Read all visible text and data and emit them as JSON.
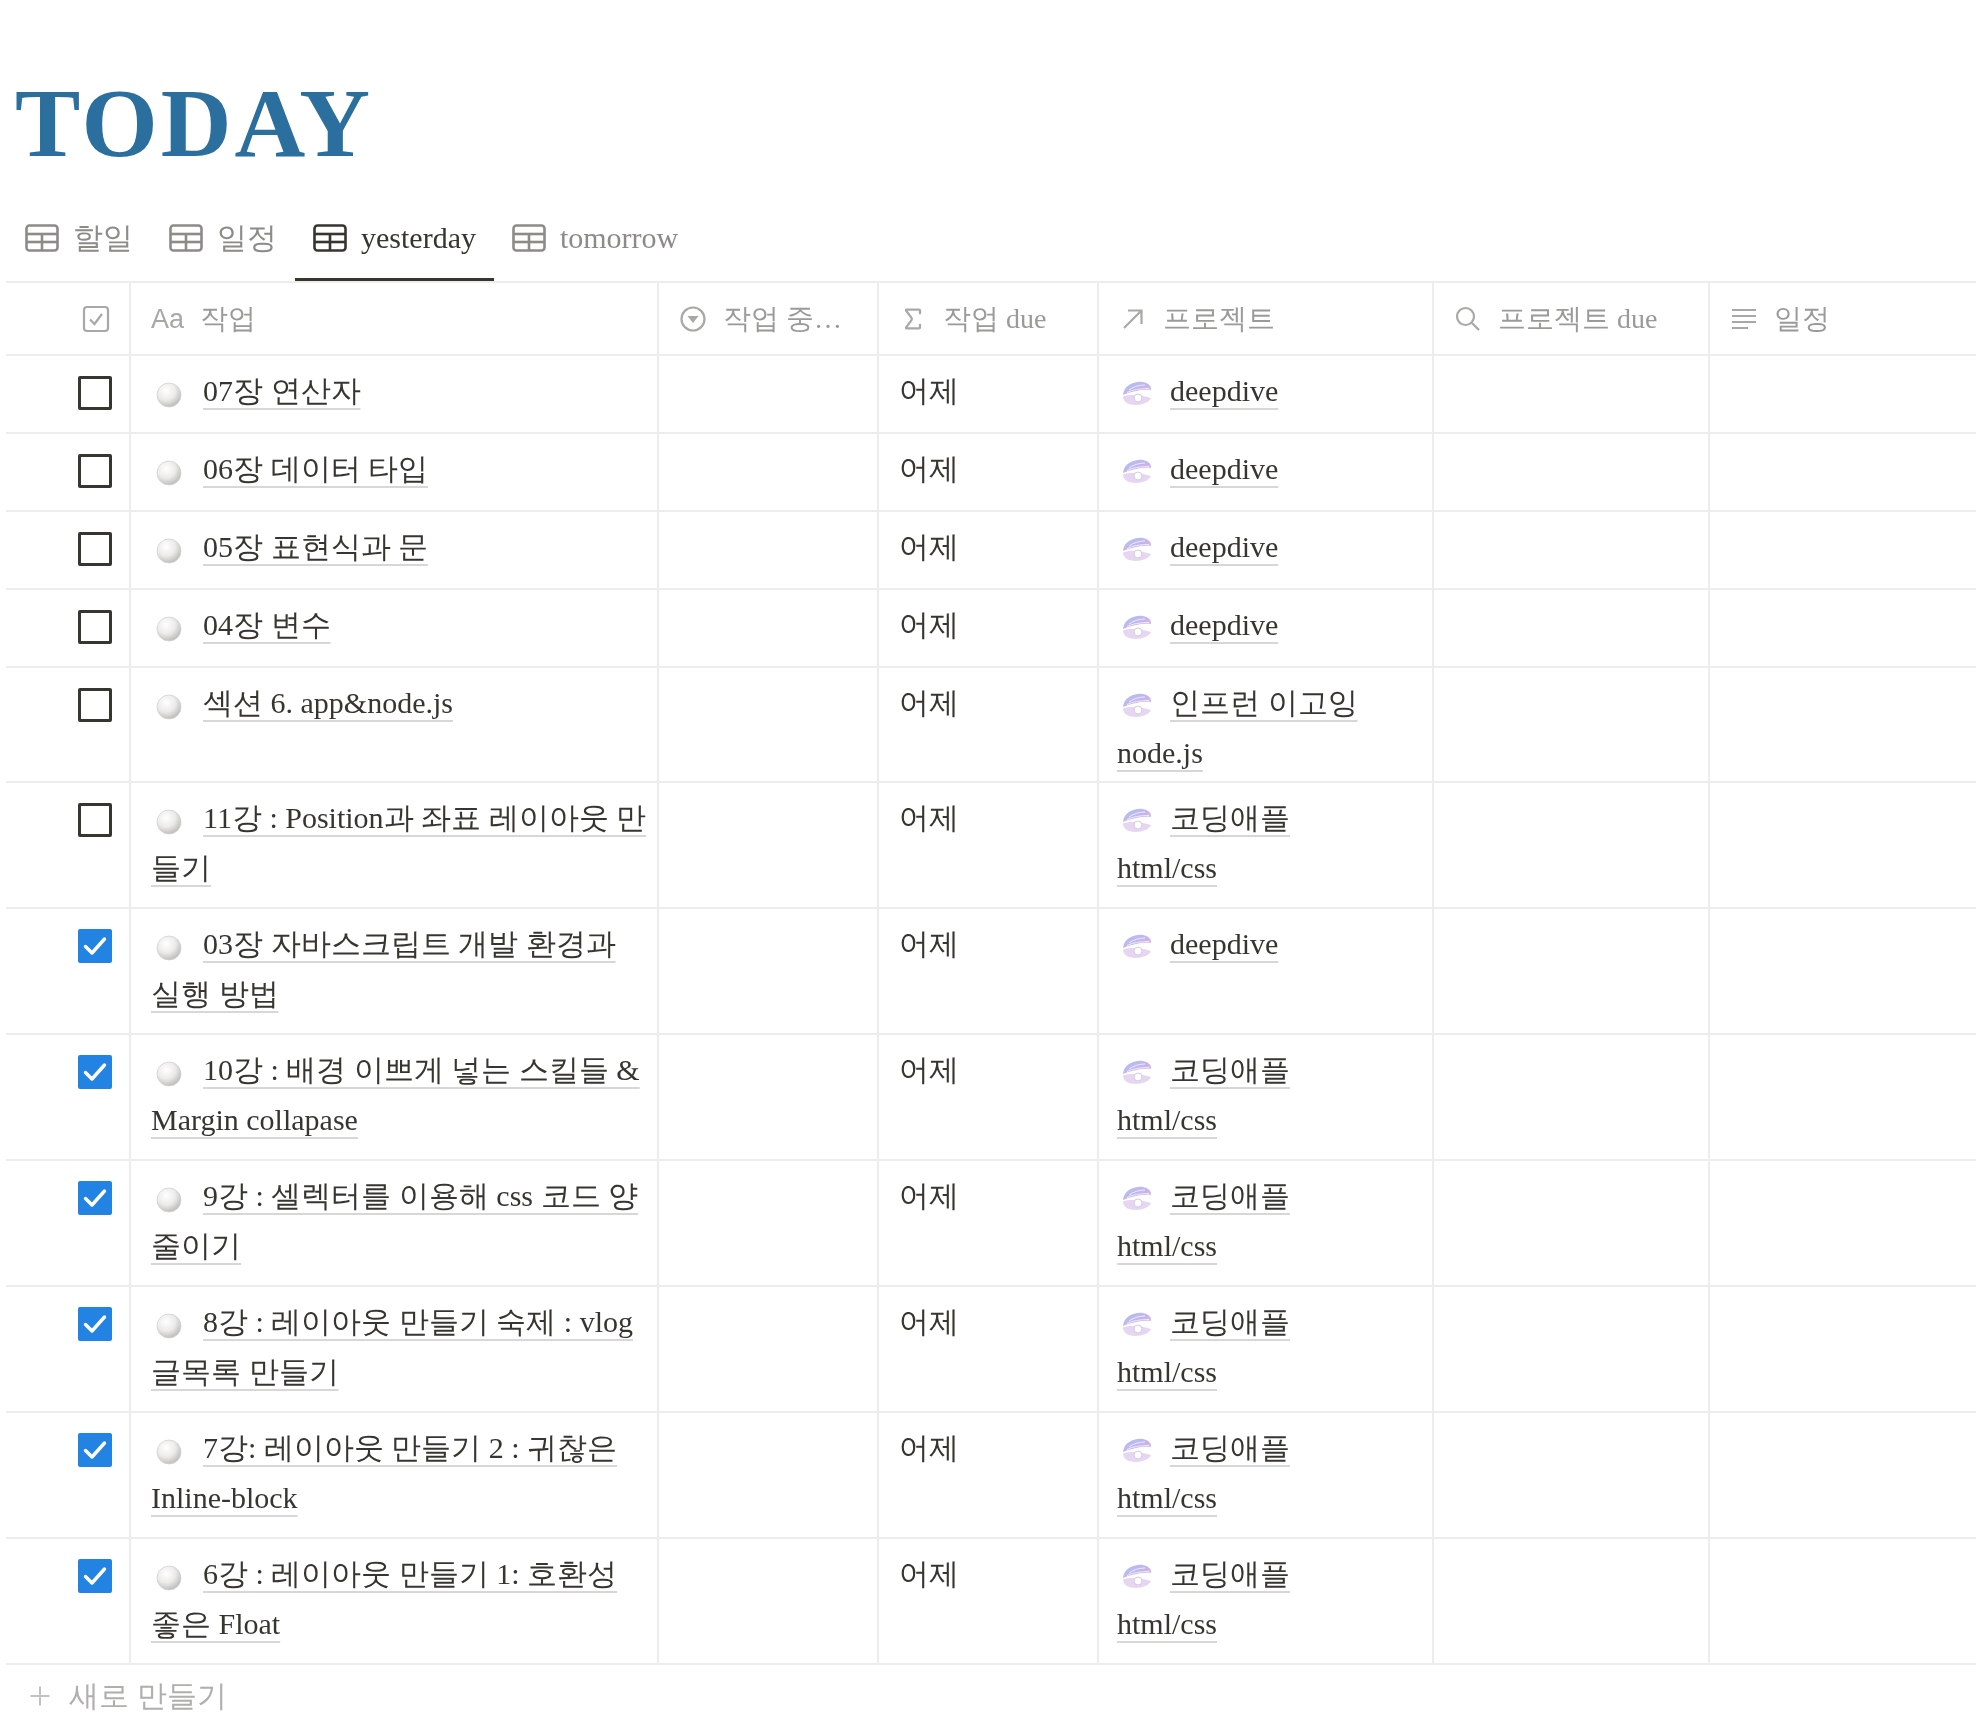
{
  "page": {
    "title": "TODAY"
  },
  "tabs": [
    {
      "label": "할일",
      "selected": false
    },
    {
      "label": "일정",
      "selected": false
    },
    {
      "label": "yesterday",
      "selected": true
    },
    {
      "label": "tomorrow",
      "selected": false
    }
  ],
  "table": {
    "columns": [
      {
        "kind": "checkbox"
      },
      {
        "kind": "title",
        "type_glyph": "Aa",
        "label": "작업"
      },
      {
        "kind": "status",
        "label": "작업 중…"
      },
      {
        "kind": "formula",
        "label": "작업 due"
      },
      {
        "kind": "relation",
        "label": "프로젝트"
      },
      {
        "kind": "rollup",
        "label": "프로젝트 due"
      },
      {
        "kind": "text",
        "label": "일정"
      }
    ],
    "rows": [
      {
        "checked": false,
        "task": "07장 연산자",
        "task_due": "어제",
        "project": "deepdive"
      },
      {
        "checked": false,
        "task": "06장 데이터 타입",
        "task_due": "어제",
        "project": "deepdive"
      },
      {
        "checked": false,
        "task": "05장 표현식과 문",
        "task_due": "어제",
        "project": "deepdive"
      },
      {
        "checked": false,
        "task": "04장 변수",
        "task_due": "어제",
        "project": "deepdive"
      },
      {
        "checked": false,
        "task": "섹션 6. app&node.js",
        "task_due": "어제",
        "project": "인프런 이고잉 node.js"
      },
      {
        "checked": false,
        "task": "11강 : Position과 좌표 레이아웃 만들기",
        "task_due": "어제",
        "project": "코딩애플 html/css"
      },
      {
        "checked": true,
        "task": "03장 자바스크립트 개발 환경과 실행 방법",
        "task_due": "어제",
        "project": "deepdive"
      },
      {
        "checked": true,
        "task": "10강 : 배경 이쁘게 넣는 스킬들 & Margin collapase",
        "task_due": "어제",
        "project": "코딩애플 html/css"
      },
      {
        "checked": true,
        "task": "9강 : 셀렉터를 이용해 css 코드 양 줄이기",
        "task_due": "어제",
        "project": "코딩애플 html/css"
      },
      {
        "checked": true,
        "task": "8강 : 레이아웃 만들기 숙제 : vlog 글목록 만들기",
        "task_due": "어제",
        "project": "코딩애플 html/css"
      },
      {
        "checked": true,
        "task": "7강: 레이아웃 만들기 2 : 귀찮은 Inline-block",
        "task_due": "어제",
        "project": "코딩애플 html/css"
      },
      {
        "checked": true,
        "task": "6강 : 레이아웃 만들기 1: 호환성 좋은 Float",
        "task_due": "어제",
        "project": "코딩애플 html/css"
      }
    ]
  },
  "new_row": {
    "label": "새로 만들기"
  }
}
